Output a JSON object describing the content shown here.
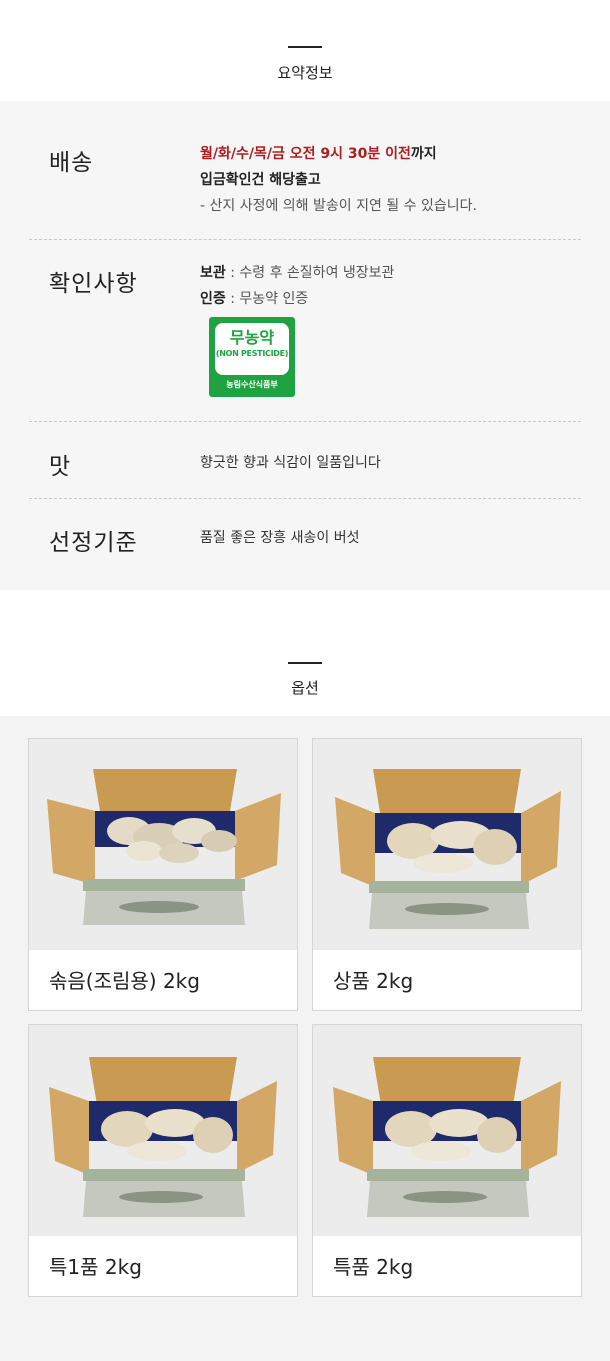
{
  "summary": {
    "title": "요약정보",
    "rows": [
      {
        "label": "배송",
        "delivery_highlight": "월/화/수/목/금 오전 9시 30분 이전",
        "delivery_suffix": "까지",
        "line2": "입금확인건 해당출고",
        "line3": "- 산지 사정에 의해 발송이 지연 될 수 있습니다."
      },
      {
        "label": "확인사항",
        "storage_key": "보관",
        "storage_value": " : 수령 후 손질하여 냉장보관",
        "cert_key": "인증",
        "cert_value": " : 무농약 인증",
        "badge": {
          "main": "무농약",
          "sub": "(NON PESTICIDE)",
          "footer": "농림수산식품부",
          "color": "#1fa341"
        }
      },
      {
        "label": "맛",
        "text": "향긋한 향과 식감이 일품입니다"
      },
      {
        "label": "선정기준",
        "text": "품질 좋은 장흥 새송이 버섯"
      }
    ]
  },
  "options": {
    "title": "옵션",
    "items": [
      {
        "label": "솎음(조림용) 2kg",
        "image": "mushroom-box-small"
      },
      {
        "label": "상품 2kg",
        "image": "mushroom-box"
      },
      {
        "label": "특1품 2kg",
        "image": "mushroom-box"
      },
      {
        "label": "특품 2kg",
        "image": "mushroom-box"
      }
    ]
  },
  "colors": {
    "accent_red": "#b01c1c",
    "badge_green": "#1fa341"
  }
}
